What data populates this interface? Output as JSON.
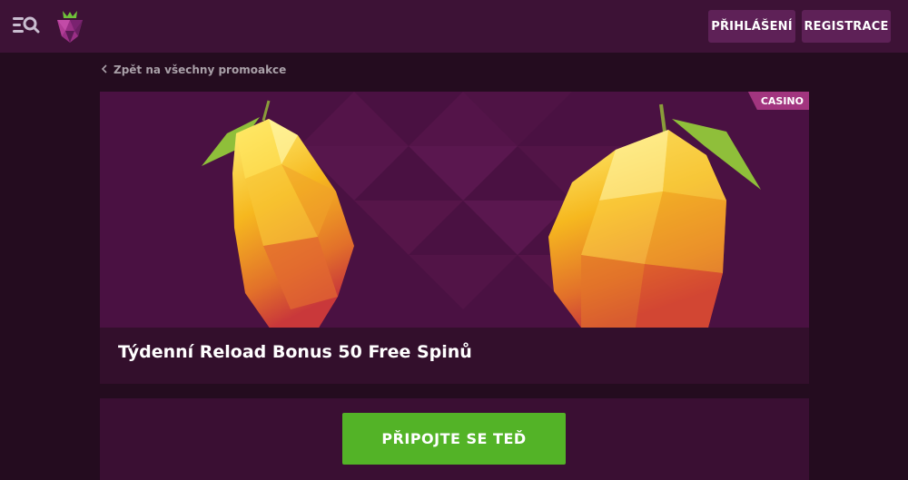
{
  "header": {
    "login_label": "PŘIHLÁŠENÍ",
    "register_label": "REGISTRACE",
    "menu_icon": "menu-search-icon",
    "logo_icon": "raspberry-logo-icon"
  },
  "breadcrumb": {
    "back_label": "Zpět na všechny promoakce",
    "icon": "chevron-left-icon"
  },
  "promo": {
    "badge": "CASINO",
    "title": "Týdenní Reload Bonus 50 Free Spinů",
    "image": "golden-lemons-illustration"
  },
  "cta": {
    "label": "PŘIPOJTE SE TEĎ"
  },
  "colors": {
    "background": "#240c1f",
    "header": "#3d1236",
    "header_button": "#5e2157",
    "badge": "#a2357f",
    "cta": "#53b327"
  }
}
